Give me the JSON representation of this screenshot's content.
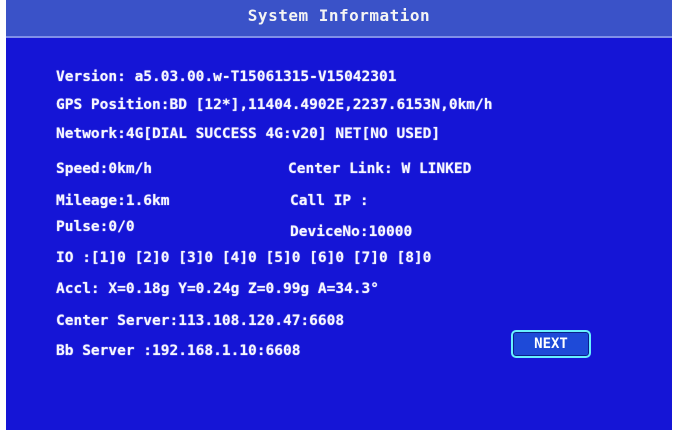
{
  "title": "System Information",
  "lines": {
    "version": "Version:  a5.03.00.w-T15061315-V15042301",
    "gps": "GPS Position:BD [12*],11404.4902E,2237.6153N,0km/h",
    "network": "Network:4G[DIAL SUCCESS 4G:v20] NET[NO USED]",
    "speed": "Speed:0km/h",
    "center_link": "Center Link: W LINKED",
    "mileage": "Mileage:1.6km",
    "call_ip": "Call IP :",
    "pulse": "Pulse:0/0",
    "device_no": "DeviceNo:10000",
    "io": "IO  :[1]0 [2]0 [3]0 [4]0 [5]0 [6]0 [7]0 [8]0",
    "accl": "Accl:  X=0.18g Y=0.24g Z=0.99g A=34.3°",
    "center_server": "Center Server:113.108.120.47:6608",
    "bb_server": "Bb Server     :192.168.1.10:6608"
  },
  "next_button": {
    "label": "NEXT"
  },
  "colors": {
    "screen_background": "#1515d6",
    "title_bar": "#3a52c8",
    "text": "#f6f6ff",
    "button_border": "#68f0ff"
  }
}
